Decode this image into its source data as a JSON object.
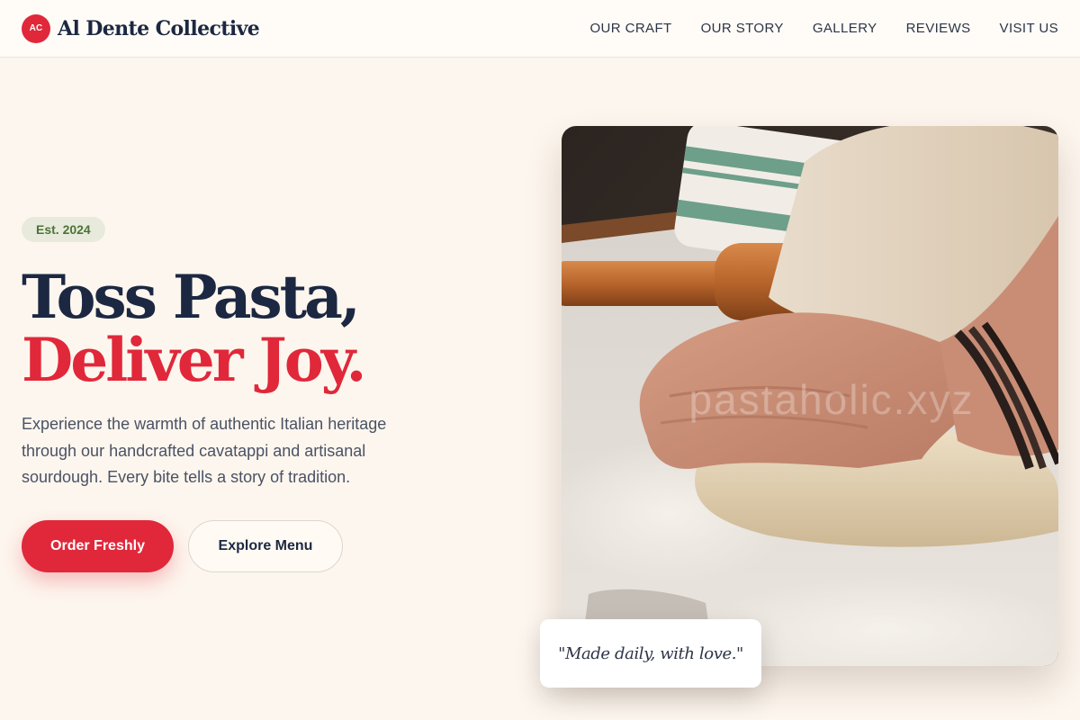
{
  "brand": {
    "logo_initials": "AC",
    "name": "Al Dente Collective"
  },
  "nav": {
    "links": [
      "OUR CRAFT",
      "OUR STORY",
      "GALLERY",
      "REVIEWS",
      "VISIT US"
    ]
  },
  "hero": {
    "badge": "Est. 2024",
    "headline_line1": "Toss Pasta,",
    "headline_line2": "Deliver Joy.",
    "description": "Experience the warmth of authentic Italian heritage through our handcrafted cavatappi and artisanal sourdough. Every bite tells a story of tradition.",
    "primary_cta": "Order Freshly",
    "secondary_cta": "Explore Menu",
    "image_icon": "dough-kneading-photo",
    "image_watermark": "pastaholic.xyz"
  },
  "quote": {
    "text": "\"Made daily, with love.\""
  },
  "colors": {
    "accent": "#e0283a",
    "navy": "#1c2841",
    "background": "#fdf6ee",
    "badge_green": "#4e7239"
  }
}
